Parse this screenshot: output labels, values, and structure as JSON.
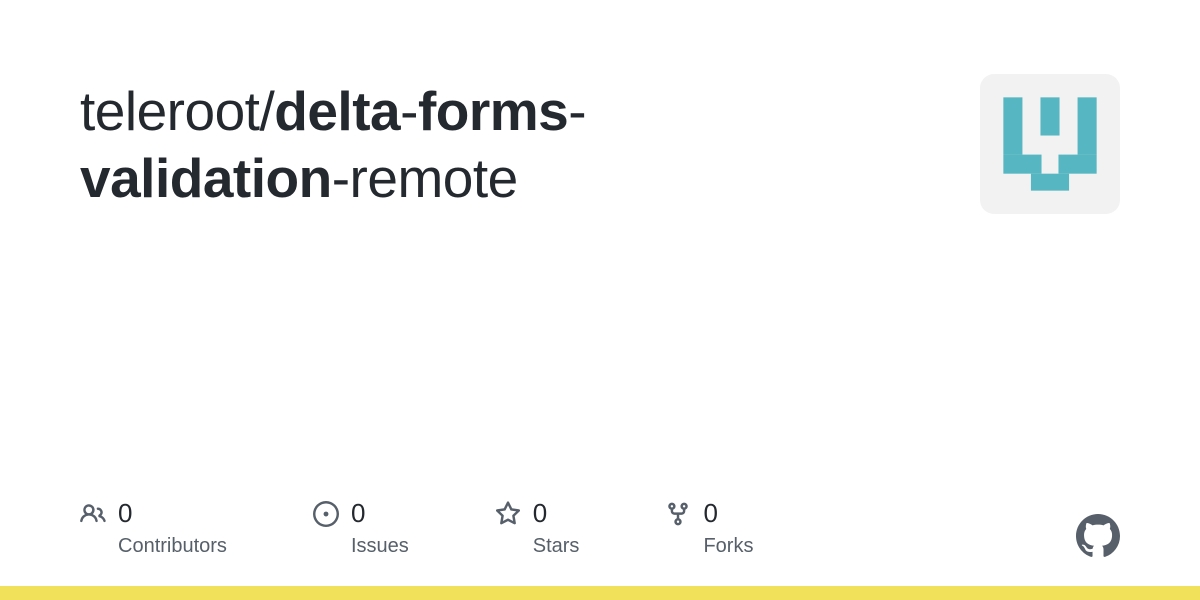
{
  "repo": {
    "owner": "teleroot",
    "separator": "/",
    "name_parts": [
      {
        "text": "delta",
        "bold": true
      },
      {
        "text": "-",
        "bold": false
      },
      {
        "text": "forms",
        "bold": true
      },
      {
        "text": "-",
        "bold": false
      },
      {
        "text": "validation",
        "bold": true
      },
      {
        "text": "-",
        "bold": false
      },
      {
        "text": "remote",
        "bold": false
      }
    ]
  },
  "stats": [
    {
      "icon": "people-icon",
      "count": "0",
      "label": "Contributors"
    },
    {
      "icon": "issue-icon",
      "count": "0",
      "label": "Issues"
    },
    {
      "icon": "star-icon",
      "count": "0",
      "label": "Stars"
    },
    {
      "icon": "fork-icon",
      "count": "0",
      "label": "Forks"
    }
  ],
  "accent_bar": [
    {
      "color": "#f1e05a",
      "width": "100%"
    }
  ],
  "avatar_color": "#56b7c2"
}
